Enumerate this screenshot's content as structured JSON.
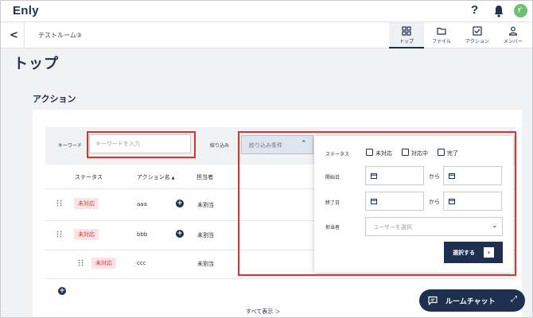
{
  "app": {
    "logo": "Enly",
    "avatar_initial": "ｹﾞ"
  },
  "header": {
    "help_icon": "?",
    "bell_icon": "bell-icon"
  },
  "room": {
    "name": "テストルーム③",
    "tabs": [
      {
        "label": "トップ",
        "icon": "grid-icon",
        "active": true
      },
      {
        "label": "ファイル",
        "icon": "folder-icon",
        "active": false
      },
      {
        "label": "アクション",
        "icon": "checkbox-icon",
        "active": false
      },
      {
        "label": "メンバー",
        "icon": "person-icon",
        "active": false
      }
    ]
  },
  "page": {
    "title": "トップ",
    "section_title": "アクション"
  },
  "filter": {
    "keyword_label": "キーワード",
    "keyword_placeholder": "キーワードを入力",
    "filter_label": "絞り込み",
    "filter_placeholder": "絞り込み条件"
  },
  "table": {
    "headers": {
      "status": "ステータス",
      "action": "アクション名",
      "sort": "▲",
      "assignee": "担当者"
    },
    "rows": [
      {
        "status": "未対応",
        "name": "aaa",
        "assignee": "未割当"
      },
      {
        "status": "未対応",
        "name": "bbb",
        "assignee": "未割当"
      },
      {
        "status": "未対応",
        "name": "ccc",
        "assignee": "未割当"
      }
    ],
    "show_all": "すべて表示 ＞"
  },
  "panel": {
    "status_label": "ステータス",
    "status_options": [
      "未対応",
      "対応中",
      "完了"
    ],
    "start_label": "開始日",
    "end_label": "終了日",
    "kara": "から",
    "assignee_label": "担当者",
    "assignee_placeholder": "ユーザーを選択",
    "apply": "選択する"
  },
  "chat": {
    "label": "ルームチャット"
  },
  "colors": {
    "brand": "#1e2f4f",
    "badge_bg": "#fde3e3",
    "badge_text": "#d33a3a",
    "highlight": "#e03131"
  }
}
